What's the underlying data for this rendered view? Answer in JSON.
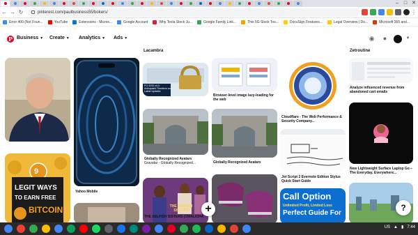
{
  "browser": {
    "url": "pinterest.com/paulbusiness55/bokers/",
    "window_controls": [
      "–",
      "□",
      "✕"
    ],
    "tab_colors": [
      "#e60023",
      "#4285f4",
      "#e60023",
      "#34a853",
      "#fbbc05",
      "#4285f4",
      "#e60023",
      "#ea4335",
      "#34a853",
      "#e60023",
      "#0a66c2",
      "#e60023",
      "#4285f4",
      "#34a853",
      "#e60023",
      "#fbbc05",
      "#ea4335",
      "#4285f4",
      "#e60023",
      "#34a853",
      "#0a66c2",
      "#e60023",
      "#4285f4",
      "#fbbc05",
      "#34a853",
      "#e60023",
      "#4285f4",
      "#ea4335",
      "#34a853",
      "#e60023",
      "#4285f4"
    ]
  },
  "bookmarks": [
    {
      "label": "Error 400 (Not Foun...",
      "color": "#4285f4"
    },
    {
      "label": "YouTube",
      "color": "#ff0000"
    },
    {
      "label": "Extensions - Micros...",
      "color": "#0078d4"
    },
    {
      "label": "Google Account",
      "color": "#4285f4"
    },
    {
      "label": "Why Tesla Stock Ju...",
      "color": "#e31937"
    },
    {
      "label": "Google Family Link...",
      "color": "#34a853"
    },
    {
      "label": "This 5G Stock Too...",
      "color": "#f4a100"
    },
    {
      "label": "DocuSign Features...",
      "color": "#ffcc00"
    },
    {
      "label": "Legal Overview | Do...",
      "color": "#ffcc00"
    },
    {
      "label": "Microsoft 365 and...",
      "color": "#d83b01"
    }
  ],
  "pinterest": {
    "logo": "P",
    "menu": [
      "Business",
      "Create",
      "Analytics",
      "Ads"
    ],
    "icons": [
      "bell-icon",
      "chat-icon",
      "avatar",
      "chevron-down-icon"
    ]
  },
  "board": {
    "column_headers": [
      "Lacambra",
      "Zetroutine"
    ],
    "pins": {
      "legit": {
        "badge": "9",
        "line1": "LEGIT WAYS",
        "line2": "TO EARN FREE",
        "line3": "BITCOIN"
      },
      "pci": {
        "overlay": "PCI DSS v4.0: Anticipated Timelines and Latest Updates"
      },
      "call_option": {
        "line1": "Call Option",
        "line2": "Unlimited Profit, Limited Loss",
        "line3": "Perfect Guide For"
      },
      "selfish": {
        "title": "THE SELFISH SISTERS"
      }
    },
    "captions": {
      "yahoo": "Yahoo Mobile",
      "lazy": "Browser-level image lazy-loading for the web",
      "cloudflare": "Cloudflare - The Web Performance & Security Company...",
      "analyze": "Analyze influenced revenue from abandoned cart emails",
      "avatars1_title": "Globally Recognized Avatars",
      "avatars1_sub": "Gravatar - Globally Recognized...",
      "avatars2_title": "Globally Recognized Avatars",
      "jot": "Jot Script 2 Evernote Edition Stylus Quick Start Guide",
      "laptop": "New Lightweight Surface Laptop Go – The Everyday, Everywhere...",
      "selfish_sub": "THE SELFISH SISTERS (OMALICHA"
    }
  },
  "fabs": {
    "add": "+",
    "help": "?"
  },
  "taskbar": {
    "apps": [
      "#4285f4",
      "#ea4335",
      "#34a853",
      "#fbbc05",
      "#4285f4",
      "#0f9d58",
      "#ff0000",
      "#1ed760",
      "#5f6368",
      "#1a73e8",
      "#00897b",
      "#7b1fa2",
      "#4285f4",
      "#e60023",
      "#34a853",
      "#1db954",
      "#0a66c2",
      "#f4b400",
      "#db4437",
      "#4285f4"
    ],
    "locale": "US",
    "time": "7:44"
  }
}
